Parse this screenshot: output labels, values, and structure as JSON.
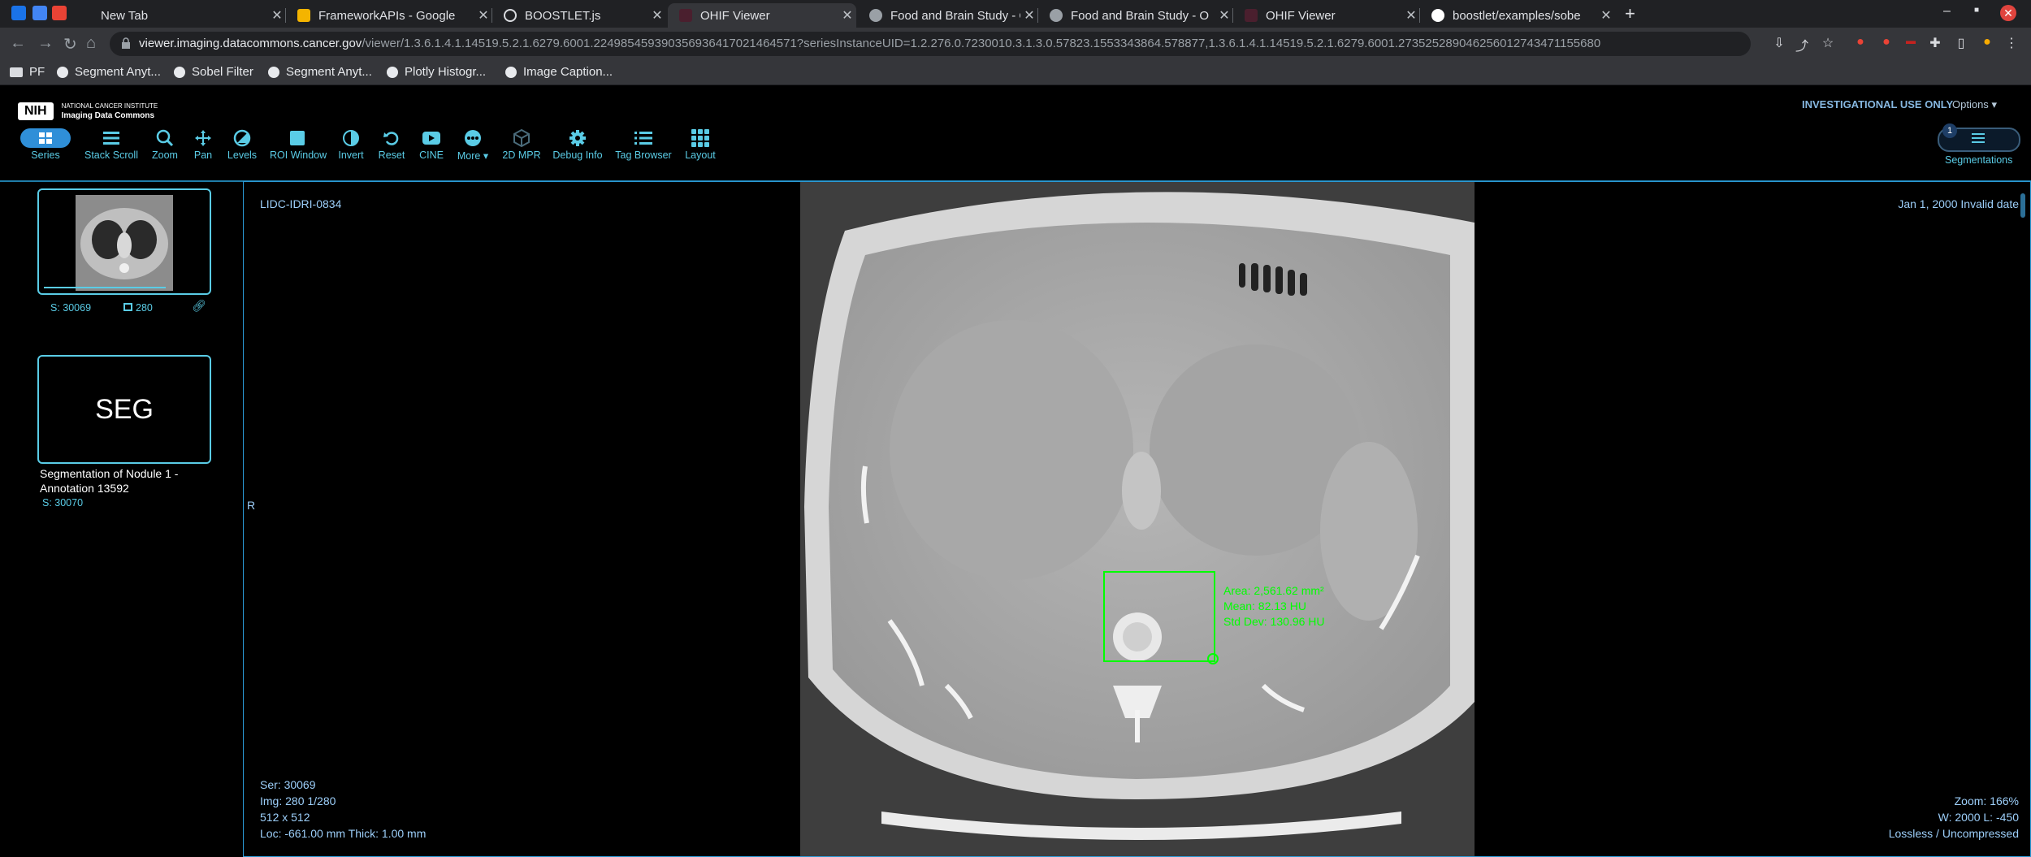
{
  "browser": {
    "tabs": [
      {
        "title": "New Tab",
        "favicon_color": "#dadce0",
        "active": false
      },
      {
        "title": "FrameworkAPIs - Google",
        "favicon_color": "#f4b400",
        "active": false
      },
      {
        "title": "BOOSTLET.js",
        "favicon_color": "#dadce0",
        "active": false
      },
      {
        "title": "OHIF Viewer",
        "favicon_color": "#4a1f2e",
        "active": true
      },
      {
        "title": "Food and Brain Study - O",
        "favicon_color": "#dadce0",
        "active": false
      },
      {
        "title": "Food and Brain Study - O",
        "favicon_color": "#dadce0",
        "active": false
      },
      {
        "title": "OHIF Viewer",
        "favicon_color": "#4a1f2e",
        "active": false
      },
      {
        "title": "boostlet/examples/sobe",
        "favicon_color": "#ffffff",
        "active": false
      }
    ],
    "url_host": "viewer.imaging.datacommons.cancer.gov",
    "url_path": "/viewer/1.3.6.1.4.1.14519.5.2.1.6279.6001.224985459390356936417021464571?seriesInstanceUID=1.2.276.0.7230010.3.1.3.0.57823.1553343864.578877,1.3.6.1.4.1.14519.5.2.1.6279.6001.273525289046256012743471155680",
    "bookmarks": [
      "PF",
      "Segment Anyt...",
      "Sobel Filter",
      "Segment Anyt...",
      "Plotly Histogr...",
      "Image Caption..."
    ]
  },
  "header": {
    "logo_mark": "NIH",
    "logo_line1": "NATIONAL CANCER INSTITUTE",
    "logo_line2": "Imaging Data Commons",
    "investigational": "INVESTIGATIONAL USE ONLY",
    "options": "Options",
    "accent": "#5acce6"
  },
  "toolbar": {
    "series": "Series",
    "stack_scroll": "Stack Scroll",
    "zoom": "Zoom",
    "pan": "Pan",
    "levels": "Levels",
    "roi_window": "ROI Window",
    "invert": "Invert",
    "reset": "Reset",
    "cine": "CINE",
    "more": "More",
    "mpr": "2D MPR",
    "debug": "Debug Info",
    "tag_browser": "Tag Browser",
    "layout": "Layout",
    "segmentations": "Segmentations",
    "seg_count": "1"
  },
  "left_panel": {
    "series_number": "S: 30069",
    "instance_count": "280",
    "seg_label": "SEG",
    "seg_description": "Segmentation of Nodule 1 - Annotation 13592",
    "seg_series_number": "S: 30070"
  },
  "viewport": {
    "patient_id": "LIDC-IDRI-0834",
    "study_date": "Jan 1, 2000 Invalid date",
    "orientation_left": "R",
    "ser": "Ser: 30069",
    "img": "Img: 280 1/280",
    "dims": "512 x 512",
    "loc": "Loc: -661.00 mm Thick: 1.00 mm",
    "zoom": "Zoom: 166%",
    "wl": "W: 2000 L: -450",
    "compression": "Lossless / Uncompressed",
    "roi": {
      "area": "Area: 2,561.62 mm²",
      "mean": "Mean: 82.13 HU",
      "std": "Std Dev: 130.96 HU",
      "color": "#00ff00"
    }
  }
}
